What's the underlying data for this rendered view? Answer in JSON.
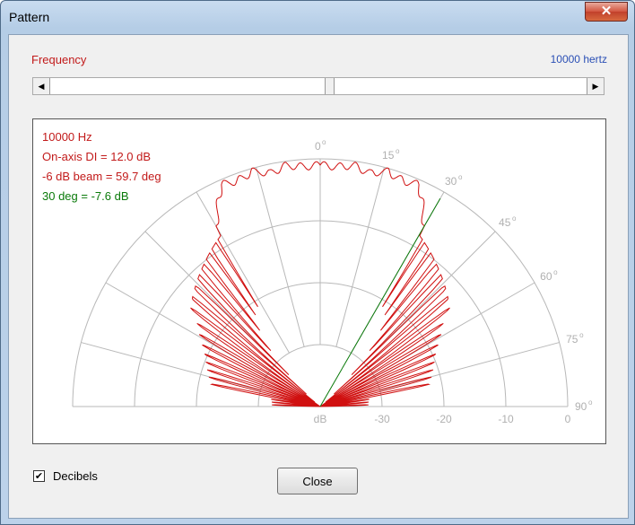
{
  "window": {
    "title": "Pattern",
    "close_glyph": "✕"
  },
  "frequency": {
    "label": "Frequency",
    "value_text": "10000 hertz",
    "slider_fraction": 0.52
  },
  "plot_info": {
    "freq": "10000 Hz",
    "di": "On-axis DI = 12.0 dB",
    "beam": "-6 dB beam = 59.7 deg",
    "angle30": "30 deg = -7.6 dB"
  },
  "colors": {
    "trace": "#d01010",
    "marker": "#0a7a0a",
    "grid": "#b8b8b8",
    "label": "#b0b0b0",
    "freq_label": "#c21a1a",
    "hz_text": "#2a4fb5"
  },
  "chart_data": {
    "type": "polar",
    "angle_labels": [
      "0",
      "15",
      "30",
      "45",
      "60",
      "75",
      "90"
    ],
    "angle_unit_mark": "o",
    "db_tick_labels": [
      "dB",
      "-30",
      "-20",
      "-10",
      "0"
    ],
    "db_range": [
      -40,
      0
    ],
    "marker_line": {
      "angle_deg": 30,
      "db": -7.6
    },
    "on_axis_di_db": 12.0,
    "beam_minus6db_deg": 59.7,
    "pattern": [
      {
        "angle": 0,
        "db": -1.0
      },
      {
        "angle": 4,
        "db": -1.2
      },
      {
        "angle": 8,
        "db": -0.7
      },
      {
        "angle": 12,
        "db": -1.5
      },
      {
        "angle": 16,
        "db": -0.5
      },
      {
        "angle": 20,
        "db": -1.2
      },
      {
        "angle": 24,
        "db": -0.8
      },
      {
        "angle": 28,
        "db": -4.5
      },
      {
        "angle": 32,
        "db": -9.0
      },
      {
        "angle": 36,
        "db": -11.8
      },
      {
        "angle": 40,
        "db": -17.0
      },
      {
        "angle": 44,
        "db": -21.5
      },
      {
        "angle": 48,
        "db": -25.0
      },
      {
        "angle": 52,
        "db": -29.0
      },
      {
        "angle": 56,
        "db": -32.0
      },
      {
        "angle": 60,
        "db": -33.5
      },
      {
        "angle": 64,
        "db": -35.0
      },
      {
        "angle": 68,
        "db": -36.0
      },
      {
        "angle": 72,
        "db": -36.8
      },
      {
        "angle": 76,
        "db": -37.5
      },
      {
        "angle": 80,
        "db": -38.2
      },
      {
        "angle": 84,
        "db": -38.5
      },
      {
        "angle": 88,
        "db": -38.6
      },
      {
        "angle": 90,
        "db": -38.6
      }
    ]
  },
  "checkbox": {
    "label": "Decibels",
    "checked": true,
    "check_glyph": "✔"
  },
  "close_button": {
    "label": "Close"
  }
}
